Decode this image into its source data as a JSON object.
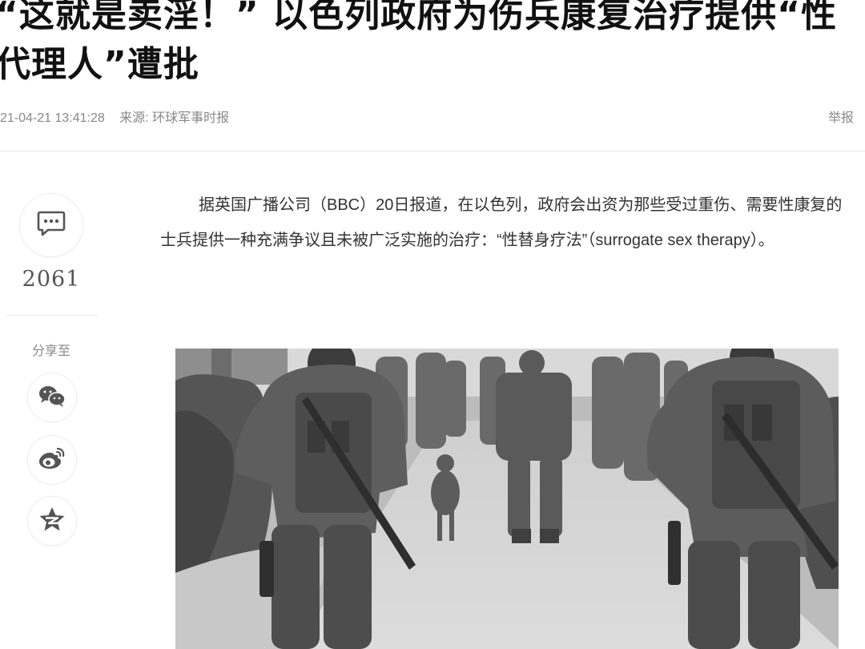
{
  "article": {
    "title": "“这就是卖淫！” 以色列政府为伤兵康复治疗提供“性代理人”遭批",
    "timestamp": "21-04-21 13:41:28",
    "source": "来源: 环球军事时报",
    "report_label": "举报",
    "paragraph": "据英国广播公司（BBC）20日报道，在以色列，政府会出资为那些受过重伤、需要性康复的士兵提供一种充满争议且未被广泛实施的治疗：“性替身疗法”（surrogate sex therapy）。"
  },
  "sidebar": {
    "comment_icon": "comment-bubble-icon",
    "comment_count": "2061",
    "share_label": "分享至",
    "share_icons": [
      "wechat-icon",
      "weibo-icon",
      "qzone-icon"
    ]
  },
  "photo": {
    "description_icon": "photo",
    "tone": "grayscale"
  },
  "colors": {
    "text": "#333333",
    "muted": "#888888",
    "divider": "#e6e6e6",
    "icon": "#555555"
  }
}
